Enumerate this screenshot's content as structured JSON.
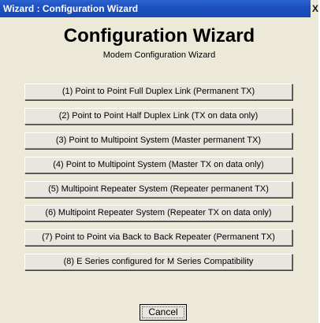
{
  "window": {
    "title": "Wizard : Configuration Wizard",
    "close_label": "X"
  },
  "header": {
    "title": "Configuration Wizard",
    "subtitle": "Modem Configuration Wizard"
  },
  "options": [
    "(1) Point to Point Full Duplex Link (Permanent TX)",
    "(2) Point to Point Half Duplex Link (TX on data only)",
    "(3) Point to Multipoint  System (Master permanent TX)",
    "(4) Point to Multipoint  System (Master TX on data only)",
    "(5) Multipoint Repeater System (Repeater permanent TX)",
    "(6) Multipoint Repeater System (Repeater TX on data only)",
    "(7) Point to Point via Back to Back Repeater (Permanent TX)",
    "(8) E Series configured for M Series Compatibility"
  ],
  "footer": {
    "cancel_label": "Cancel"
  },
  "colors": {
    "titlebar": "#1c4fc0",
    "background": "#ece9d8",
    "button_face": "#e8e6de"
  }
}
